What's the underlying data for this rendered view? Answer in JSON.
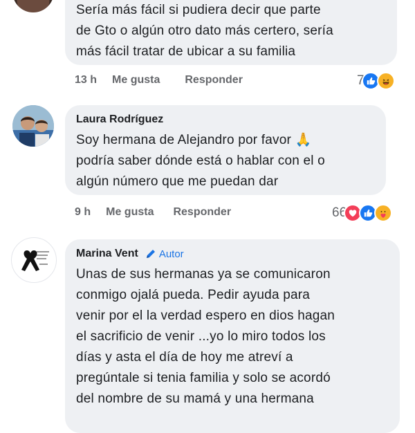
{
  "comments": [
    {
      "text": "Sería más fácil si pudiera decir que parte\nde Gto o algún otro dato más certero, sería\nmás fácil tratar de ubicar a su familia",
      "time": "13 h",
      "like_label": "Me gusta",
      "reply_label": "Responder",
      "reaction_count": "7",
      "reactions": [
        "like-icon",
        "haha-icon"
      ]
    },
    {
      "author": "Laura Rodríguez",
      "text": "Soy hermana de Alejandro por favor 🙏\npodría saber dónde está o hablar con el o\nalgún número que me puedan dar",
      "time": "9 h",
      "like_label": "Me gusta",
      "reply_label": "Responder",
      "reaction_count": "66",
      "reactions": [
        "love-icon",
        "like-icon",
        "care-icon"
      ]
    },
    {
      "author": "Marina Vent",
      "author_badge": "Autor",
      "text": "Unas de sus hermanas ya se comunicaron\nconmigo ojalá pueda. Pedir ayuda para\nvenir por el la verdad espero en dios hagan\nel sacrificio de venir ...yo lo miro todos los\ndías y asta el día de hoy me atreví a\npregúntale si tenia familia y solo se acordó\ndel nombre de su mamá y una hermana"
    }
  ],
  "colors": {
    "bubble": "#eef0f3",
    "meta": "#65676b",
    "link_blue": "#1b74e4",
    "like": "#1877f2",
    "love": "#f33e58",
    "haha": "#f7b125"
  }
}
